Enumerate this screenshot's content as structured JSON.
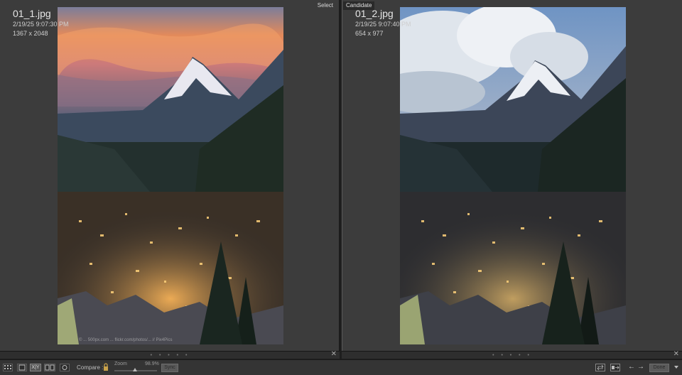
{
  "left_panel": {
    "tag": "Select",
    "filename": "01_1.jpg",
    "datetime": "2/19/25 9:07:30 PM",
    "dimensions": "1367 x 2048",
    "watermark": "© ... 500px.com ... flickr.com/photos/... // Pix4Pics",
    "sky_colors": [
      "#5a5f8a",
      "#e27a50",
      "#f0c08a"
    ]
  },
  "right_panel": {
    "tag": "Candidate",
    "filename": "01_2.jpg",
    "datetime": "2/19/25 9:07:40 PM",
    "dimensions": "654 x 977",
    "sky_colors": [
      "#6f94c4",
      "#9fb9d8",
      "#dfe6ef"
    ]
  },
  "toolbar": {
    "compare_label": "Compare :",
    "zoom_label": "Zoom",
    "zoom_value": "98.9%",
    "sync_label": "Sync",
    "done_label": "Done",
    "prev_arrow": "←",
    "next_arrow": "→",
    "close_glyph": "✕",
    "xy_label": "X|Y"
  }
}
